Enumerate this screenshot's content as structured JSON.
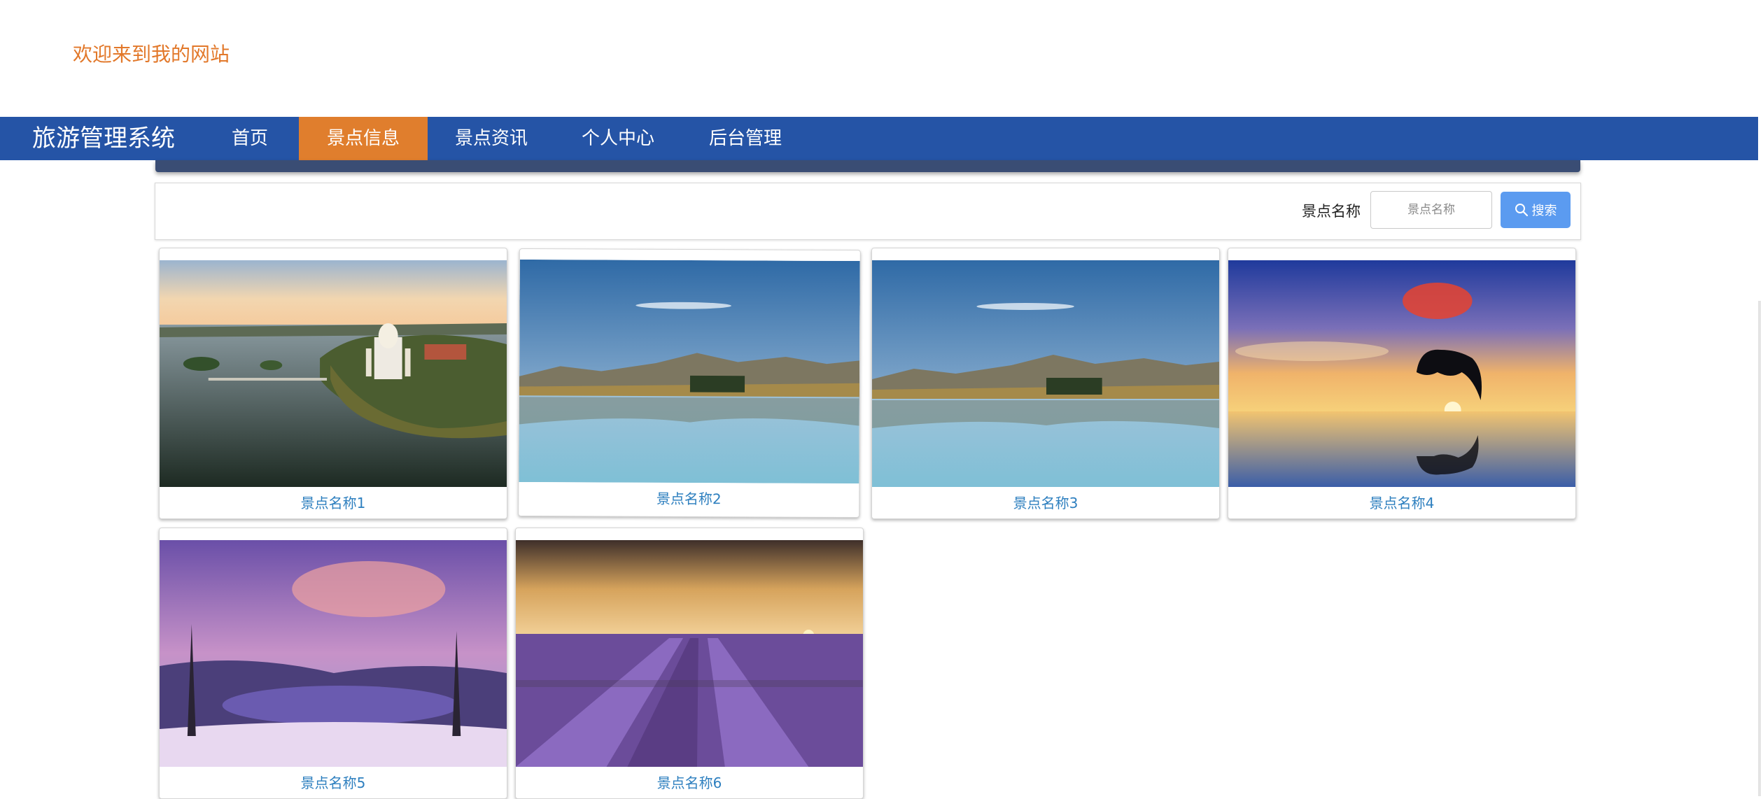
{
  "header": {
    "welcome_text": "欢迎来到我的网站"
  },
  "nav": {
    "brand": "旅游管理系统",
    "items": [
      {
        "label": "首页"
      },
      {
        "label": "景点信息",
        "active": true
      },
      {
        "label": "景点资讯"
      },
      {
        "label": "个人中心"
      },
      {
        "label": "后台管理"
      }
    ]
  },
  "search": {
    "label": "景点名称",
    "placeholder": "景点名称",
    "value": "",
    "button_label": "搜索"
  },
  "spots": [
    {
      "name": "景点名称1",
      "image": "castle-lake-aerial"
    },
    {
      "name": "景点名称2",
      "image": "mountain-lake-reflection"
    },
    {
      "name": "景点名称3",
      "image": "mountain-lake-reflection"
    },
    {
      "name": "景点名称4",
      "image": "dolphin-sunset"
    },
    {
      "name": "景点名称5",
      "image": "crater-lake-purple-sky"
    },
    {
      "name": "景点名称6",
      "image": "lavender-field-sunset"
    }
  ],
  "colors": {
    "nav_bg": "#2554a6",
    "nav_active": "#e07e2d",
    "welcome": "#e2782a",
    "link": "#2d7fbf",
    "search_button": "#5b9bf0"
  }
}
